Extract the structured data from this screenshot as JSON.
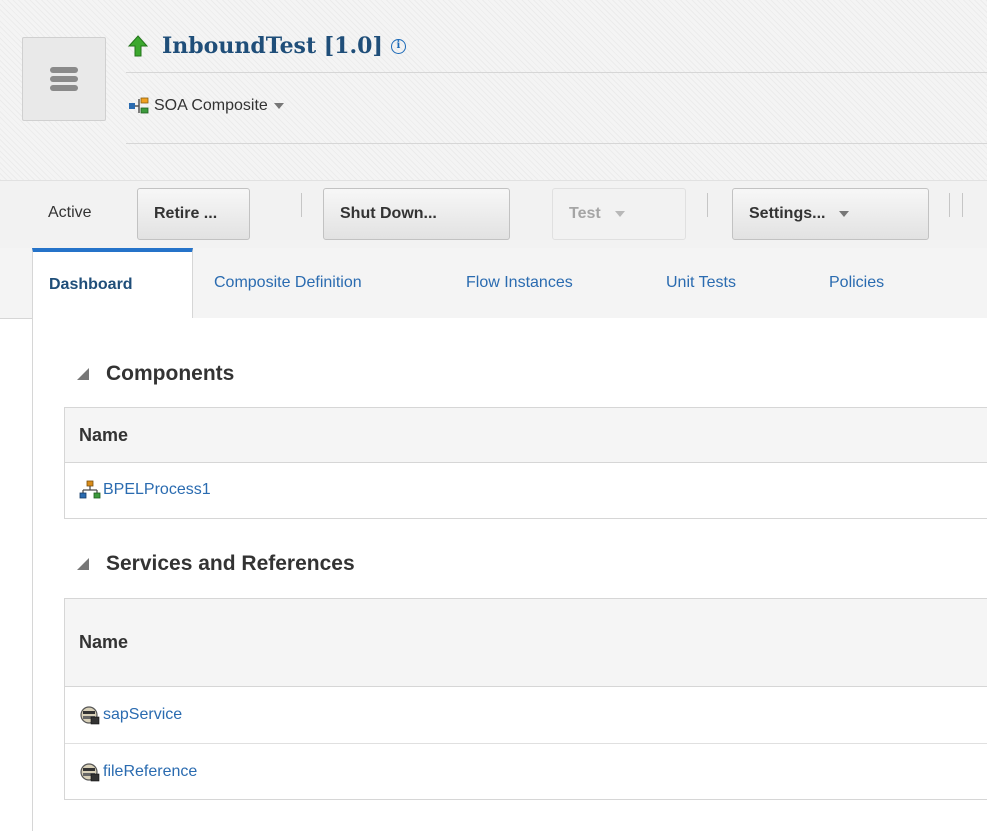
{
  "header": {
    "title": "InboundTest [1.0]",
    "subtitle": "SOA Composite"
  },
  "toolbar": {
    "status_label": "Active",
    "retire_label": "Retire ...",
    "shutdown_label": "Shut Down...",
    "test_label": "Test",
    "settings_label": "Settings..."
  },
  "tabs": [
    {
      "label": "Dashboard",
      "selected": true
    },
    {
      "label": "Composite Definition",
      "selected": false
    },
    {
      "label": "Flow Instances",
      "selected": false
    },
    {
      "label": "Unit Tests",
      "selected": false
    },
    {
      "label": "Policies",
      "selected": false
    }
  ],
  "components": {
    "heading": "Components",
    "column_header": "Name",
    "rows": [
      {
        "name": "BPELProcess1",
        "icon": "bpel-process-icon"
      }
    ]
  },
  "services": {
    "heading": "Services and References",
    "column_header": "Name",
    "rows": [
      {
        "name": "sapService",
        "icon": "adapter-service-icon"
      },
      {
        "name": "fileReference",
        "icon": "adapter-reference-icon"
      }
    ]
  },
  "colors": {
    "link": "#2a6bb0",
    "title": "#1f4e79",
    "tab_accent": "#2573c9",
    "up_arrow": "#3ca82e"
  }
}
